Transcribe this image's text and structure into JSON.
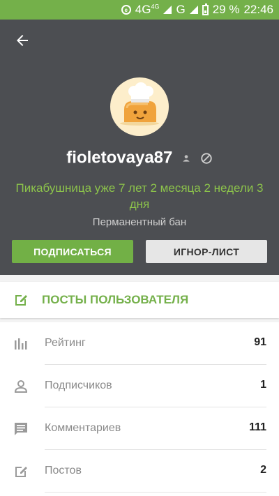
{
  "status_bar": {
    "network_4g": "4G",
    "network_4g_small": "4G",
    "network_g": "G",
    "battery_percent": "29 %",
    "time": "22:46"
  },
  "profile": {
    "username": "fioletovaya87",
    "tenure": "Пикабушница уже 7 лет 2 месяца 2 недели 3 дня",
    "ban_status": "Перманентный бан",
    "subscribe_label": "ПОДПИСАТЬСЯ",
    "ignore_label": "ИГНОР-ЛИСТ"
  },
  "posts_link": {
    "label": "ПОСТЫ ПОЛЬЗОВАТЕЛЯ"
  },
  "stats": [
    {
      "label": "Рейтинг",
      "value": "91",
      "icon": "bar-chart-icon"
    },
    {
      "label": "Подписчиков",
      "value": "1",
      "icon": "person-icon"
    },
    {
      "label": "Комментариев",
      "value": "111",
      "icon": "comment-icon"
    },
    {
      "label": "Постов",
      "value": "2",
      "icon": "edit-icon"
    }
  ],
  "colors": {
    "status_bar": "#74b04a",
    "header_bg": "#4c4e52",
    "accent_green": "#72b046",
    "tenure_text": "#8cc34b"
  }
}
